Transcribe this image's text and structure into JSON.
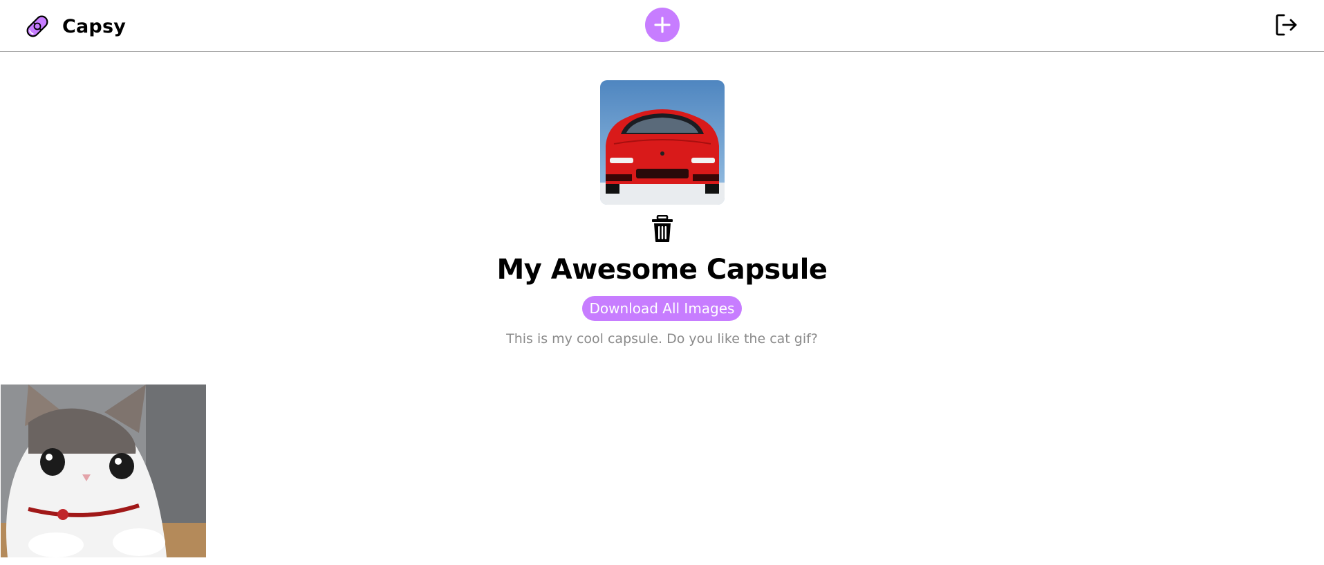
{
  "header": {
    "brand_name": "Capsy",
    "logo_icon": "pill-capsule-icon",
    "add_icon": "plus-icon",
    "logout_icon": "logout-icon"
  },
  "capsule": {
    "cover_alt": "Red sports car front view",
    "delete_icon": "trash-icon",
    "title": "My Awesome Capsule",
    "download_label": "Download All Images",
    "description": "This is my cool capsule. Do you like the cat gif?"
  },
  "gallery": {
    "items": [
      {
        "alt": "Cat gif"
      }
    ]
  },
  "colors": {
    "accent": "#c77dff",
    "text": "#000000",
    "muted": "#8a8a8a",
    "divider": "#a9a9a9"
  }
}
